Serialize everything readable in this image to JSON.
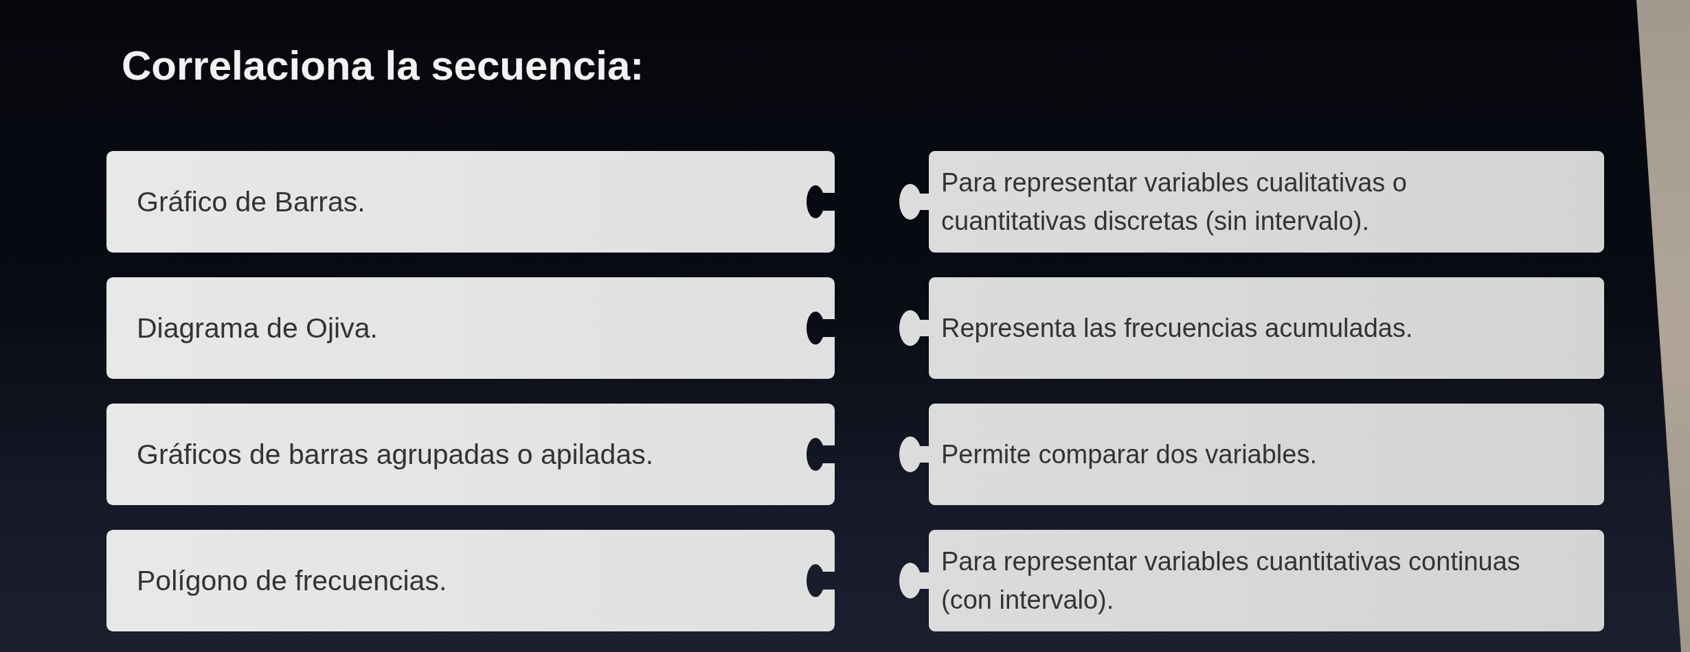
{
  "title": "Correlaciona la secuencia:",
  "terms": [
    "Gráfico de Barras.",
    "Diagrama de Ojiva.",
    "Gráficos de barras agrupadas o apiladas.",
    "Polígono de frecuencias."
  ],
  "definitions": [
    {
      "lines": [
        "Para representar variables cualitativas o",
        "cuantitativas discretas (sin intervalo)."
      ]
    },
    {
      "lines": [
        "Representa las frecuencias acumuladas."
      ]
    },
    {
      "lines": [
        "Permite comparar dos variables."
      ]
    },
    {
      "lines": [
        "Para representar variables cuantitativas continuas",
        "(con intervalo)."
      ]
    }
  ]
}
